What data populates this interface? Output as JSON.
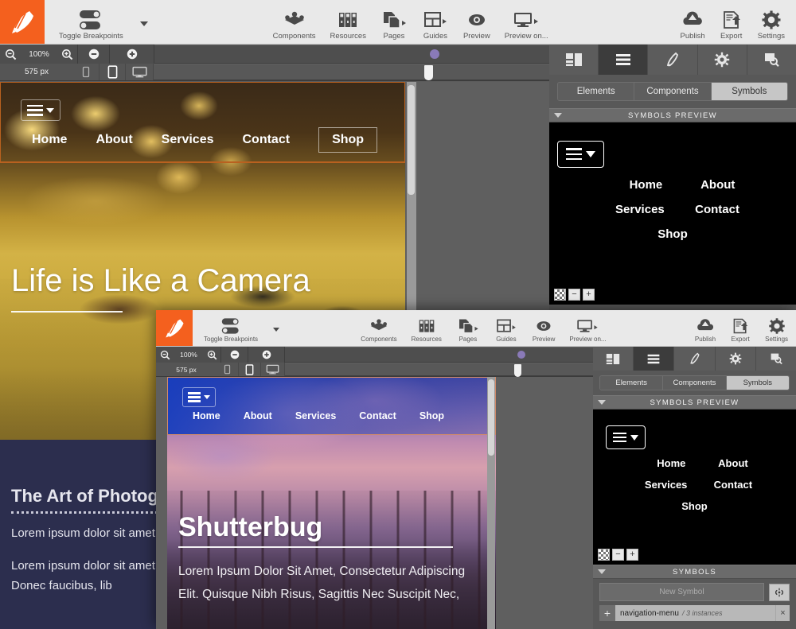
{
  "app": {
    "accent_orange": "#f4601e",
    "logo_icon": "rocket-pencil-logo"
  },
  "toolbar": {
    "toggle_breakpoints_label": "Toggle Breakpoints",
    "items": [
      {
        "label": "Components",
        "icon": "components-cube-icon",
        "dropdown": false
      },
      {
        "label": "Resources",
        "icon": "resources-binders-icon",
        "dropdown": false
      },
      {
        "label": "Pages",
        "icon": "pages-documents-icon",
        "dropdown": true
      },
      {
        "label": "Guides",
        "icon": "guides-grid-icon",
        "dropdown": true
      },
      {
        "label": "Preview",
        "icon": "preview-eye-icon",
        "dropdown": false
      },
      {
        "label": "Preview on...",
        "icon": "preview-on-monitor-icon",
        "dropdown": true
      }
    ],
    "right_items": [
      {
        "label": "Publish",
        "icon": "publish-cloud-upload-icon"
      },
      {
        "label": "Export",
        "icon": "export-document-arrow-icon"
      },
      {
        "label": "Settings",
        "icon": "settings-gear-icon"
      }
    ]
  },
  "zoombar": {
    "zoom_out_icon": "magnifier-minus-icon",
    "zoom_level": "100%",
    "zoom_in_icon": "magnifier-plus-icon",
    "minus_icon": "circle-minus-icon",
    "plus_icon": "circle-plus-icon"
  },
  "breakpointbar": {
    "width_label": "575 px",
    "devices": [
      {
        "name": "phone-small",
        "active": false
      },
      {
        "name": "tablet",
        "active": true
      },
      {
        "name": "desktop",
        "active": false
      }
    ]
  },
  "site": {
    "nav": {
      "hamburger_icon": "hamburger-menu-icon",
      "caret_icon": "chevron-down-icon",
      "links": [
        "Home",
        "About",
        "Services",
        "Contact",
        "Shop"
      ]
    },
    "hero1": {
      "title": "Life is Like a Camera",
      "image_alt": "woman-lying-in-autumn-field"
    },
    "hero2": {
      "title": "Shutterbug",
      "subtitle": "Lorem Ipsum Dolor Sit Amet, Consectetur Adipiscing Elit. Quisque Nibh Risus, Sagittis Nec Suscipit Nec,",
      "image_alt": "bare-trees-at-purple-sunset"
    },
    "dark_section": {
      "heading": "The Art of Photography",
      "paragraph1": "Lorem ipsum dolor sit amet. Maecenas et metus.",
      "paragraph2": "Lorem ipsum dolor sit amet. Quisque nibh risus, sagittis nec eros. Donec faucibus, lib"
    }
  },
  "panel": {
    "tabs": [
      {
        "name": "layout-tab",
        "icon": "layout-panel-icon",
        "active": false
      },
      {
        "name": "list-tab",
        "icon": "list-lines-icon",
        "active": true
      },
      {
        "name": "style-tab",
        "icon": "pen-style-icon",
        "active": false
      },
      {
        "name": "settings-tab",
        "icon": "gear-icon",
        "active": false
      },
      {
        "name": "inspect-tab",
        "icon": "magnifier-inspect-icon",
        "active": false
      }
    ],
    "segments": [
      {
        "label": "Elements",
        "active": false
      },
      {
        "label": "Components",
        "active": false
      },
      {
        "label": "Symbols",
        "active": true
      }
    ],
    "symbols_preview_header": "SYMBOLS PREVIEW",
    "symbols_header": "SYMBOLS",
    "preview_links_row1": [
      "Home",
      "About"
    ],
    "preview_links_row2": [
      "Services",
      "Contact"
    ],
    "preview_links_row3": [
      "Shop"
    ],
    "zoom_tools": [
      {
        "name": "transparency-checker-toggle",
        "glyph": ""
      },
      {
        "name": "preview-zoom-out",
        "glyph": "−"
      },
      {
        "name": "preview-zoom-in",
        "glyph": "+"
      }
    ],
    "new_symbol_placeholder": "New Symbol",
    "link_symbol_icon": "link-symbol-icon",
    "symbol_item": {
      "add_icon": "+",
      "name": "navigation-menu",
      "instances": "/ 3 instances",
      "remove_icon": "×"
    }
  }
}
